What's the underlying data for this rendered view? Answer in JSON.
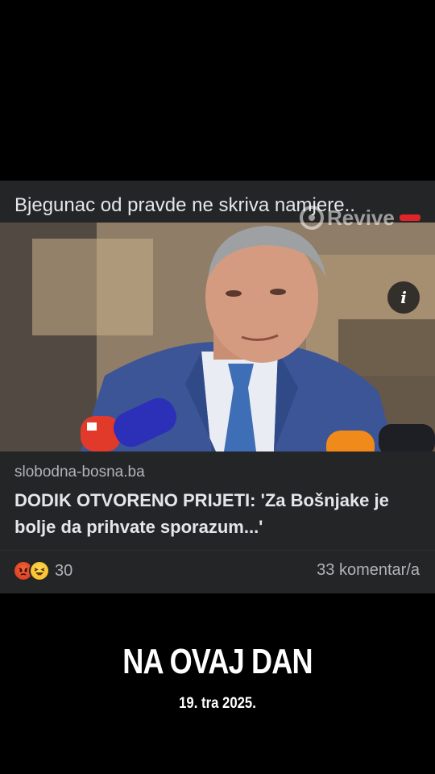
{
  "post": {
    "caption": "Bjegunac od pravde ne skriva namjere..",
    "watermark": "Revive",
    "info_label": "i",
    "link": {
      "source": "slobodna-bosna.ba",
      "headline": "DODIK OTVORENO PRIJETI: 'Za Bošnjake je bolje da prihvate sporazum...'"
    },
    "reactions": {
      "icons": [
        "angry-reaction-icon",
        "haha-reaction-icon"
      ],
      "count": "30"
    },
    "comments": "33 komentar/a"
  },
  "footer": {
    "title": "NA OVAJ DAN",
    "date": "19. tra 2025."
  },
  "colors": {
    "card": "#242526",
    "text_primary": "#e4e6eb",
    "text_secondary": "#b0b3b8"
  }
}
